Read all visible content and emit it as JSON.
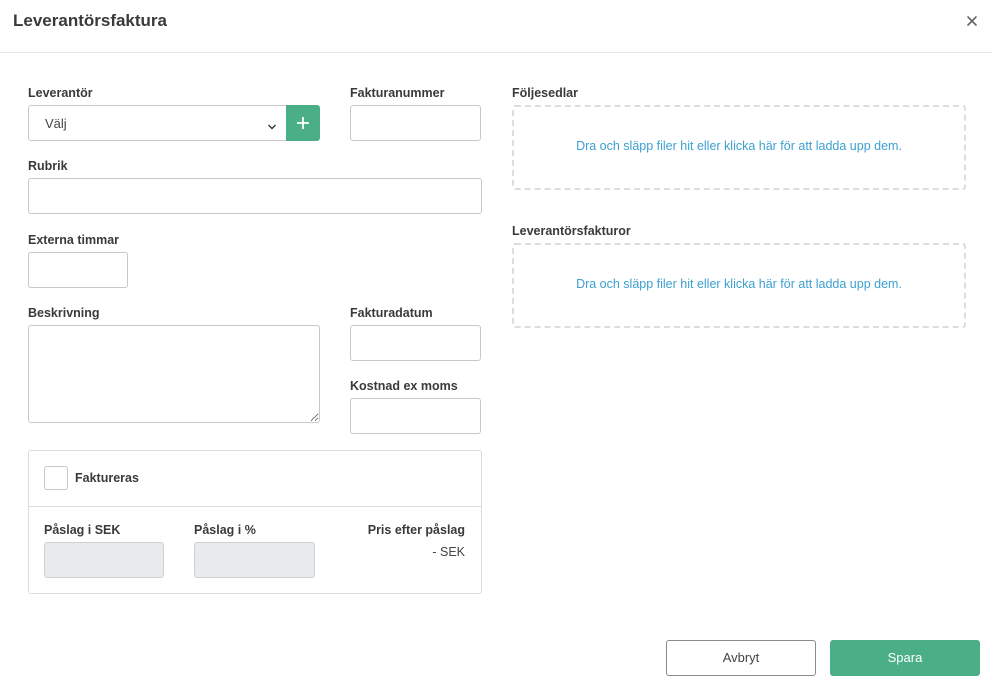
{
  "dialog": {
    "title": "Leverantörsfaktura"
  },
  "form": {
    "leverantor": {
      "label": "Leverantör",
      "selected": "Välj"
    },
    "fakturanummer": {
      "label": "Fakturanummer",
      "value": ""
    },
    "rubrik": {
      "label": "Rubrik",
      "value": ""
    },
    "externa_timmar": {
      "label": "Externa timmar",
      "value": ""
    },
    "beskrivning": {
      "label": "Beskrivning",
      "value": ""
    },
    "fakturadatum": {
      "label": "Fakturadatum",
      "value": ""
    },
    "kostnad": {
      "label": "Kostnad ex moms",
      "value": ""
    },
    "faktureras": {
      "label": "Faktureras",
      "checked": false,
      "paslag_sek_label": "Påslag i SEK",
      "paslag_pct_label": "Påslag i %",
      "pris_label": "Pris efter påslag",
      "pris_value": "- SEK"
    }
  },
  "uploads": {
    "foljesedlar": {
      "label": "Följesedlar",
      "hint": "Dra och släpp filer hit eller klicka här för att ladda upp dem."
    },
    "leverantorsfakturor": {
      "label": "Leverantörsfakturor",
      "hint": "Dra och släpp filer hit eller klicka här för att ladda upp dem."
    }
  },
  "footer": {
    "cancel_label": "Avbryt",
    "save_label": "Spara"
  },
  "colors": {
    "accent": "#4aaf86",
    "link": "#3ca0d0"
  },
  "icons": {
    "close": "close-icon",
    "chevron": "chevron-down-icon",
    "add": "plus-icon"
  }
}
